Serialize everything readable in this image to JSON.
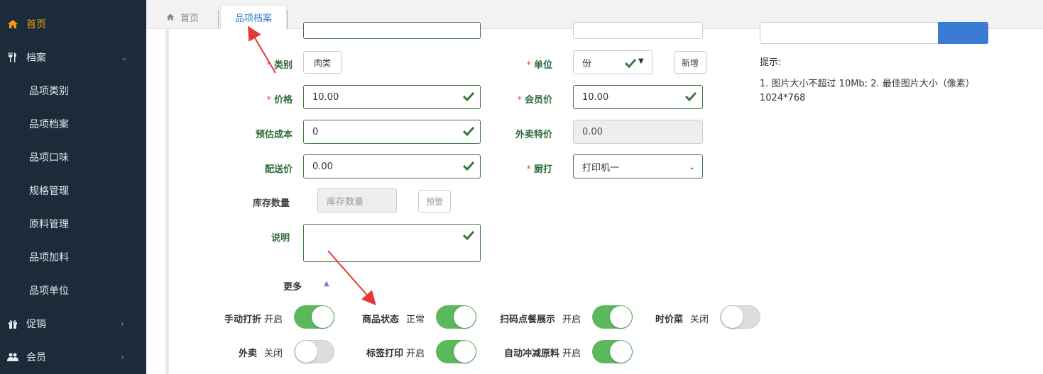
{
  "sidebar": {
    "items": [
      {
        "label": "首页",
        "icon": "home-icon"
      },
      {
        "label": "档案",
        "icon": "utensils-icon"
      },
      {
        "label": "品项类别"
      },
      {
        "label": "品项档案"
      },
      {
        "label": "品项口味"
      },
      {
        "label": "规格管理"
      },
      {
        "label": "原料管理"
      },
      {
        "label": "品项加料"
      },
      {
        "label": "品项单位"
      },
      {
        "label": "促销",
        "icon": "gift-icon"
      },
      {
        "label": "会员",
        "icon": "users-icon"
      }
    ]
  },
  "tabs": {
    "home": "首页",
    "active": "品项档案"
  },
  "form": {
    "category_label": "类别",
    "category_value": "肉类",
    "unit_label": "单位",
    "unit_value": "份",
    "add_button": "新增",
    "price_label": "价格",
    "price_value": "10.00",
    "member_price_label": "会员价",
    "member_price_value": "10.00",
    "cost_label": "预估成本",
    "cost_value": "0",
    "takeout_price_label": "外卖特价",
    "takeout_price_value": "0.00",
    "delivery_label": "配送价",
    "delivery_value": "0.00",
    "kitchen_label": "厨打",
    "kitchen_value": "打印机一",
    "stock_label": "库存数量",
    "stock_placeholder": "库存数量",
    "warn_button": "预警",
    "desc_label": "说明",
    "more_label": "更多"
  },
  "toggles": [
    {
      "label": "手动打折",
      "state": "开启",
      "on": true
    },
    {
      "label": "商品状态",
      "state": "正常",
      "on": true
    },
    {
      "label": "扫码点餐展示",
      "state": "开启",
      "on": true
    },
    {
      "label": "时价菜",
      "state": "关闭",
      "on": false
    },
    {
      "label": "外卖",
      "state": "关闭",
      "on": false
    },
    {
      "label": "标签打印",
      "state": "开启",
      "on": true
    },
    {
      "label": "自动冲减原料",
      "state": "开启",
      "on": true
    }
  ],
  "tips": {
    "title": "提示:",
    "line1": "1. 图片大小不超过 10Mb; 2. 最佳图片大小（像素）",
    "line2": "1024*768"
  },
  "colors": {
    "sidebar_bg": "#1b2b3a",
    "accent_orange": "#f39c12",
    "success_green": "#5cb85c",
    "label_green": "#2e6a3a",
    "link_blue": "#3a7bd5",
    "required_red": "#d9534f",
    "arrow_red": "#e53935"
  }
}
